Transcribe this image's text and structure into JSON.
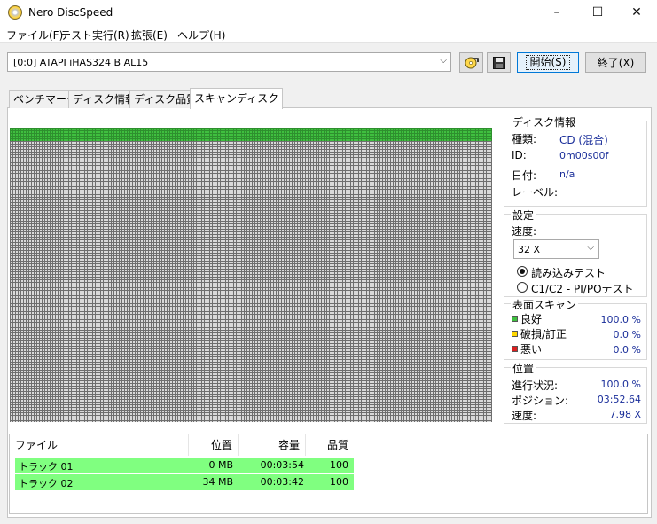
{
  "window": {
    "title": "Nero DiscSpeed",
    "minimize_glyph": "–",
    "maximize_glyph": "☐",
    "close_glyph": "✕"
  },
  "menu": {
    "items": [
      "ファイル(F)",
      "テスト実行(R)",
      "拡張(E)",
      "ヘルプ(H)"
    ]
  },
  "toolbar": {
    "drive": "[0:0]   ATAPI iHAS324   B AL15",
    "start_label": "開始(S)",
    "exit_label": "終了(X)"
  },
  "tabs": [
    {
      "label": "ベンチマーク",
      "active": false
    },
    {
      "label": "ディスク情報",
      "active": false
    },
    {
      "label": "ディスク品質",
      "active": false
    },
    {
      "label": "スキャンディスク",
      "active": true
    }
  ],
  "scan": {
    "good_fraction_rows": 0.045,
    "colors": {
      "good": "#3fbf3f",
      "unscanned": "#d9d9d9",
      "damaged": "#ffd800",
      "bad": "#d92020"
    }
  },
  "disc_info": {
    "title": "ディスク情報",
    "type_label": "種類:",
    "type_value": "CD (混合)",
    "id_label": "ID:",
    "id_value": "0m00s00f",
    "date_label": "日付:",
    "date_value": "n/a",
    "label_label": "レーベル:"
  },
  "settings": {
    "title": "設定",
    "speed_label": "速度:",
    "speed_value": "32 X",
    "read_test_label": "読み込みテスト",
    "c1c2_label": "C1/C2 - PI/POテスト"
  },
  "surface": {
    "title": "表面スキャン",
    "good_label": "良好",
    "good_value": "100.0 %",
    "damaged_label": "破損/訂正",
    "damaged_value": "0.0 %",
    "bad_label": "悪い",
    "bad_value": "0.0 %"
  },
  "position": {
    "title": "位置",
    "progress_label": "進行状況:",
    "progress_value": "100.0 %",
    "position_label": "ポジション:",
    "position_value": "03:52.64",
    "speed_label": "速度:",
    "speed_value": "7.98 X"
  },
  "tracks": {
    "headers": [
      "ファイル",
      "位置",
      "容量",
      "品質"
    ],
    "rows": [
      {
        "name": "トラック 01",
        "pos": "0 MB",
        "size": "00:03:54",
        "quality": "100"
      },
      {
        "name": "トラック 02",
        "pos": "34 MB",
        "size": "00:03:42",
        "quality": "100"
      }
    ]
  }
}
